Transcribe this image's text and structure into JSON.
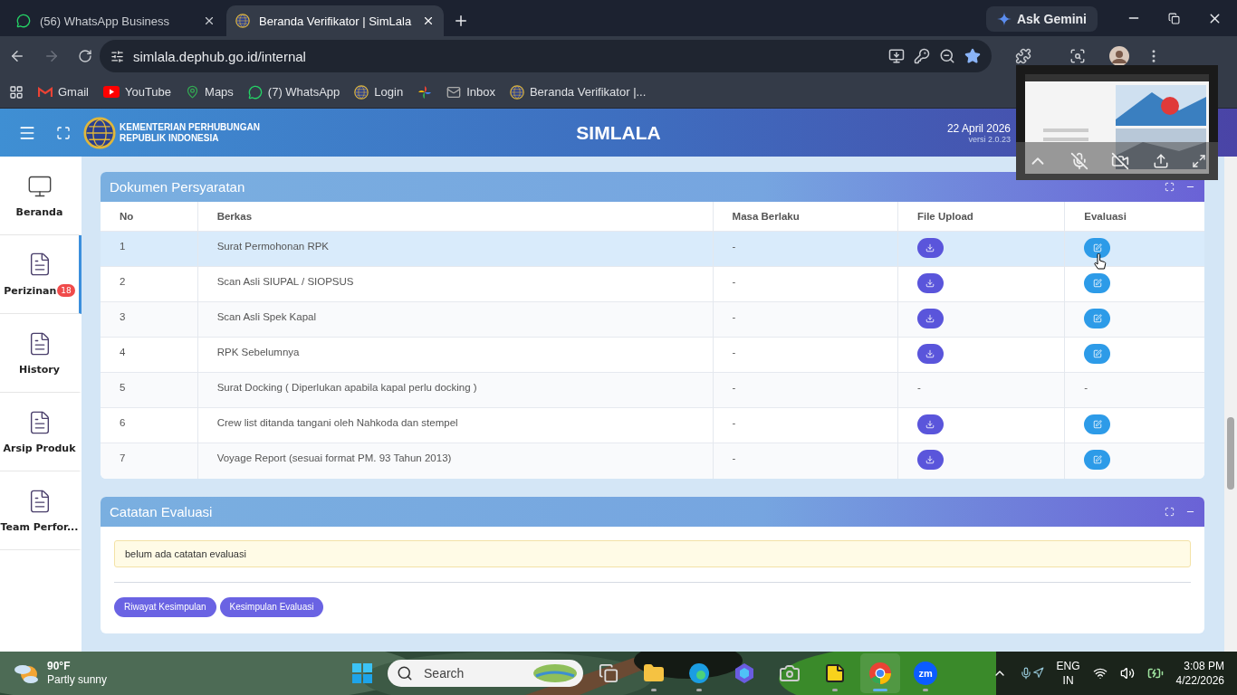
{
  "browser": {
    "tabs": [
      {
        "title": "(56) WhatsApp Business",
        "selected": false
      },
      {
        "title": "Beranda Verifikator | SimLala",
        "selected": true
      }
    ],
    "gemini": "Ask Gemini",
    "url": "simlala.dephub.go.id/internal",
    "bookmarks": [
      "Gmail",
      "YouTube",
      "Maps",
      "(7) WhatsApp",
      "Login",
      "Inbox",
      "Beranda Verifikator |..."
    ]
  },
  "header": {
    "org_line1": "KEMENTERIAN PERHUBUNGAN",
    "org_line2": "REPUBLIK INDONESIA",
    "app_title": "SIMLALA",
    "date": "22 April 2026",
    "version": "versi 2.0.23"
  },
  "sidebar": {
    "items": [
      {
        "label": "Beranda",
        "selected": false
      },
      {
        "label": "Perizinan",
        "selected": true,
        "badge": "18"
      },
      {
        "label": "History",
        "selected": false
      },
      {
        "label": "Arsip Produk",
        "selected": false
      },
      {
        "label": "Team Perfor...",
        "selected": false
      }
    ]
  },
  "documents": {
    "title": "Dokumen Persyaratan",
    "columns": [
      "No",
      "Berkas",
      "Masa Berlaku",
      "File Upload",
      "Evaluasi"
    ],
    "rows": [
      {
        "no": "1",
        "berkas": "Surat Permohonan RPK",
        "masa_berlaku": "-",
        "file_upload": {
          "kind": "button"
        },
        "evaluasi": {
          "kind": "button"
        },
        "highlighted": true
      },
      {
        "no": "2",
        "berkas": "Scan Asli SIUPAL / SIOPSUS",
        "masa_berlaku": "-",
        "file_upload": {
          "kind": "button"
        },
        "evaluasi": {
          "kind": "button"
        },
        "highlighted": false
      },
      {
        "no": "3",
        "berkas": "Scan Asli Spek Kapal",
        "masa_berlaku": "-",
        "file_upload": {
          "kind": "button"
        },
        "evaluasi": {
          "kind": "button"
        },
        "highlighted": false
      },
      {
        "no": "4",
        "berkas": "RPK Sebelumnya",
        "masa_berlaku": "-",
        "file_upload": {
          "kind": "button"
        },
        "evaluasi": {
          "kind": "button"
        },
        "highlighted": false
      },
      {
        "no": "5",
        "berkas": "Surat Docking ( Diperlukan apabila kapal perlu docking )",
        "masa_berlaku": "-",
        "file_upload": {
          "kind": "text",
          "text": "-"
        },
        "evaluasi": {
          "kind": "text",
          "text": "-"
        },
        "highlighted": false
      },
      {
        "no": "6",
        "berkas": "Crew list ditanda tangani oleh Nahkoda dan stempel",
        "masa_berlaku": "-",
        "file_upload": {
          "kind": "button"
        },
        "evaluasi": {
          "kind": "button"
        },
        "highlighted": false
      },
      {
        "no": "7",
        "berkas": "Voyage Report (sesuai format PM. 93 Tahun 2013)",
        "masa_berlaku": "-",
        "file_upload": {
          "kind": "button"
        },
        "evaluasi": {
          "kind": "button"
        },
        "highlighted": false
      }
    ]
  },
  "evaluation": {
    "title": "Catatan Evaluasi",
    "note": "belum ada catatan evaluasi",
    "buttons": [
      "Riwayat Kesimpulan",
      "Kesimpulan Evaluasi"
    ]
  },
  "taskbar": {
    "temperature": "90°F",
    "condition": "Partly sunny",
    "search": {
      "placeholder": "Search"
    },
    "apps": [
      {
        "open": false,
        "active": false
      },
      {
        "open": true,
        "active": false
      },
      {
        "open": true,
        "active": false
      },
      {
        "open": false,
        "active": false
      },
      {
        "open": false,
        "active": false
      },
      {
        "open": true,
        "active": false
      },
      {
        "open": true,
        "active": true
      },
      {
        "open": true,
        "active": false,
        "logo": "zm"
      }
    ],
    "language": "ENG",
    "region": "IN",
    "time": "3:08 PM",
    "date": "4/22/2026"
  }
}
